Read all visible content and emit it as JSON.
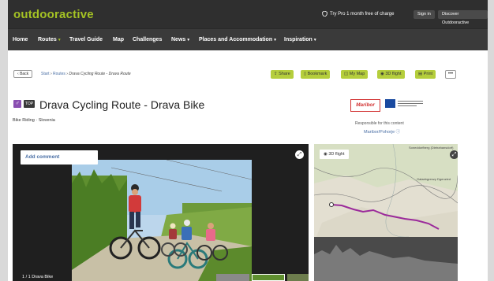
{
  "header": {
    "logo": "outdooractive",
    "try_pro": "Try Pro 1 month free of charge",
    "sign_in": "Sign in",
    "discover": "Discover Outdooractive"
  },
  "nav": {
    "items": [
      {
        "label": "Home",
        "dropdown": false
      },
      {
        "label": "Routes",
        "dropdown": true
      },
      {
        "label": "Travel Guide",
        "dropdown": false
      },
      {
        "label": "Map",
        "dropdown": false
      },
      {
        "label": "Challenges",
        "dropdown": false
      },
      {
        "label": "News",
        "dropdown": true
      },
      {
        "label": "Places and Accommodation",
        "dropdown": true
      },
      {
        "label": "Inspiration",
        "dropdown": true
      }
    ]
  },
  "toolbar": {
    "back": "Back",
    "breadcrumb": [
      "Start",
      "Routes",
      "Drava Cycling Route - Drava Route"
    ],
    "actions": [
      "Share",
      "Bookmark",
      "My Map",
      "3D flight",
      "Print"
    ],
    "more": "•••"
  },
  "route": {
    "badge": "TOP",
    "title": "Drava Cycling Route - Drava Bike",
    "subtitle": "Bike Riding · Slovenia"
  },
  "publisher": {
    "logo_text": "Maribor",
    "responsible": "Responsible for this content",
    "name": "Maribor/Pohorje"
  },
  "gallery": {
    "add_comment": "Add comment",
    "caption": "1 / 1   Drava Bike"
  },
  "map": {
    "flight_button": "3D flight",
    "labels": [
      "Soneddorfberg (Dietrahansdorf)",
      "Galaebgrenzy Dgenzied"
    ]
  },
  "colors": {
    "brand_green": "#a4c224",
    "action_green": "#b5ce3c",
    "route_line": "#9b2a9b",
    "dark_bar": "#2f2f2f"
  }
}
